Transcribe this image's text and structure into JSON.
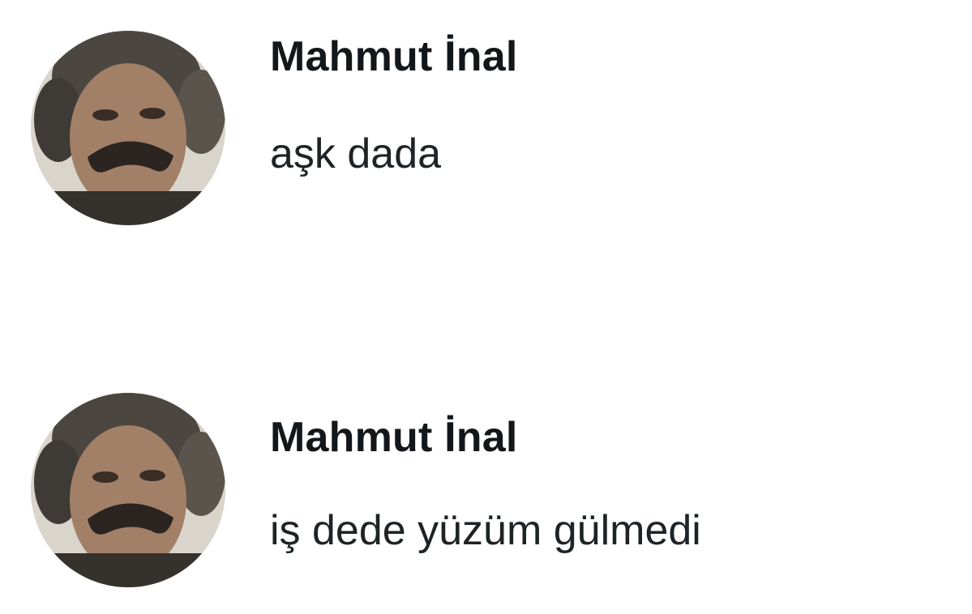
{
  "posts": [
    {
      "author": "Mahmut İnal",
      "text": "aşk dada",
      "avatar_icon": "avatar-photo"
    },
    {
      "author": "Mahmut İnal",
      "text": "iş dede yüzüm gülmedi",
      "avatar_icon": "avatar-photo"
    }
  ],
  "colors": {
    "background": "#ffffff",
    "name": "#14171a",
    "text": "#1e2326"
  }
}
